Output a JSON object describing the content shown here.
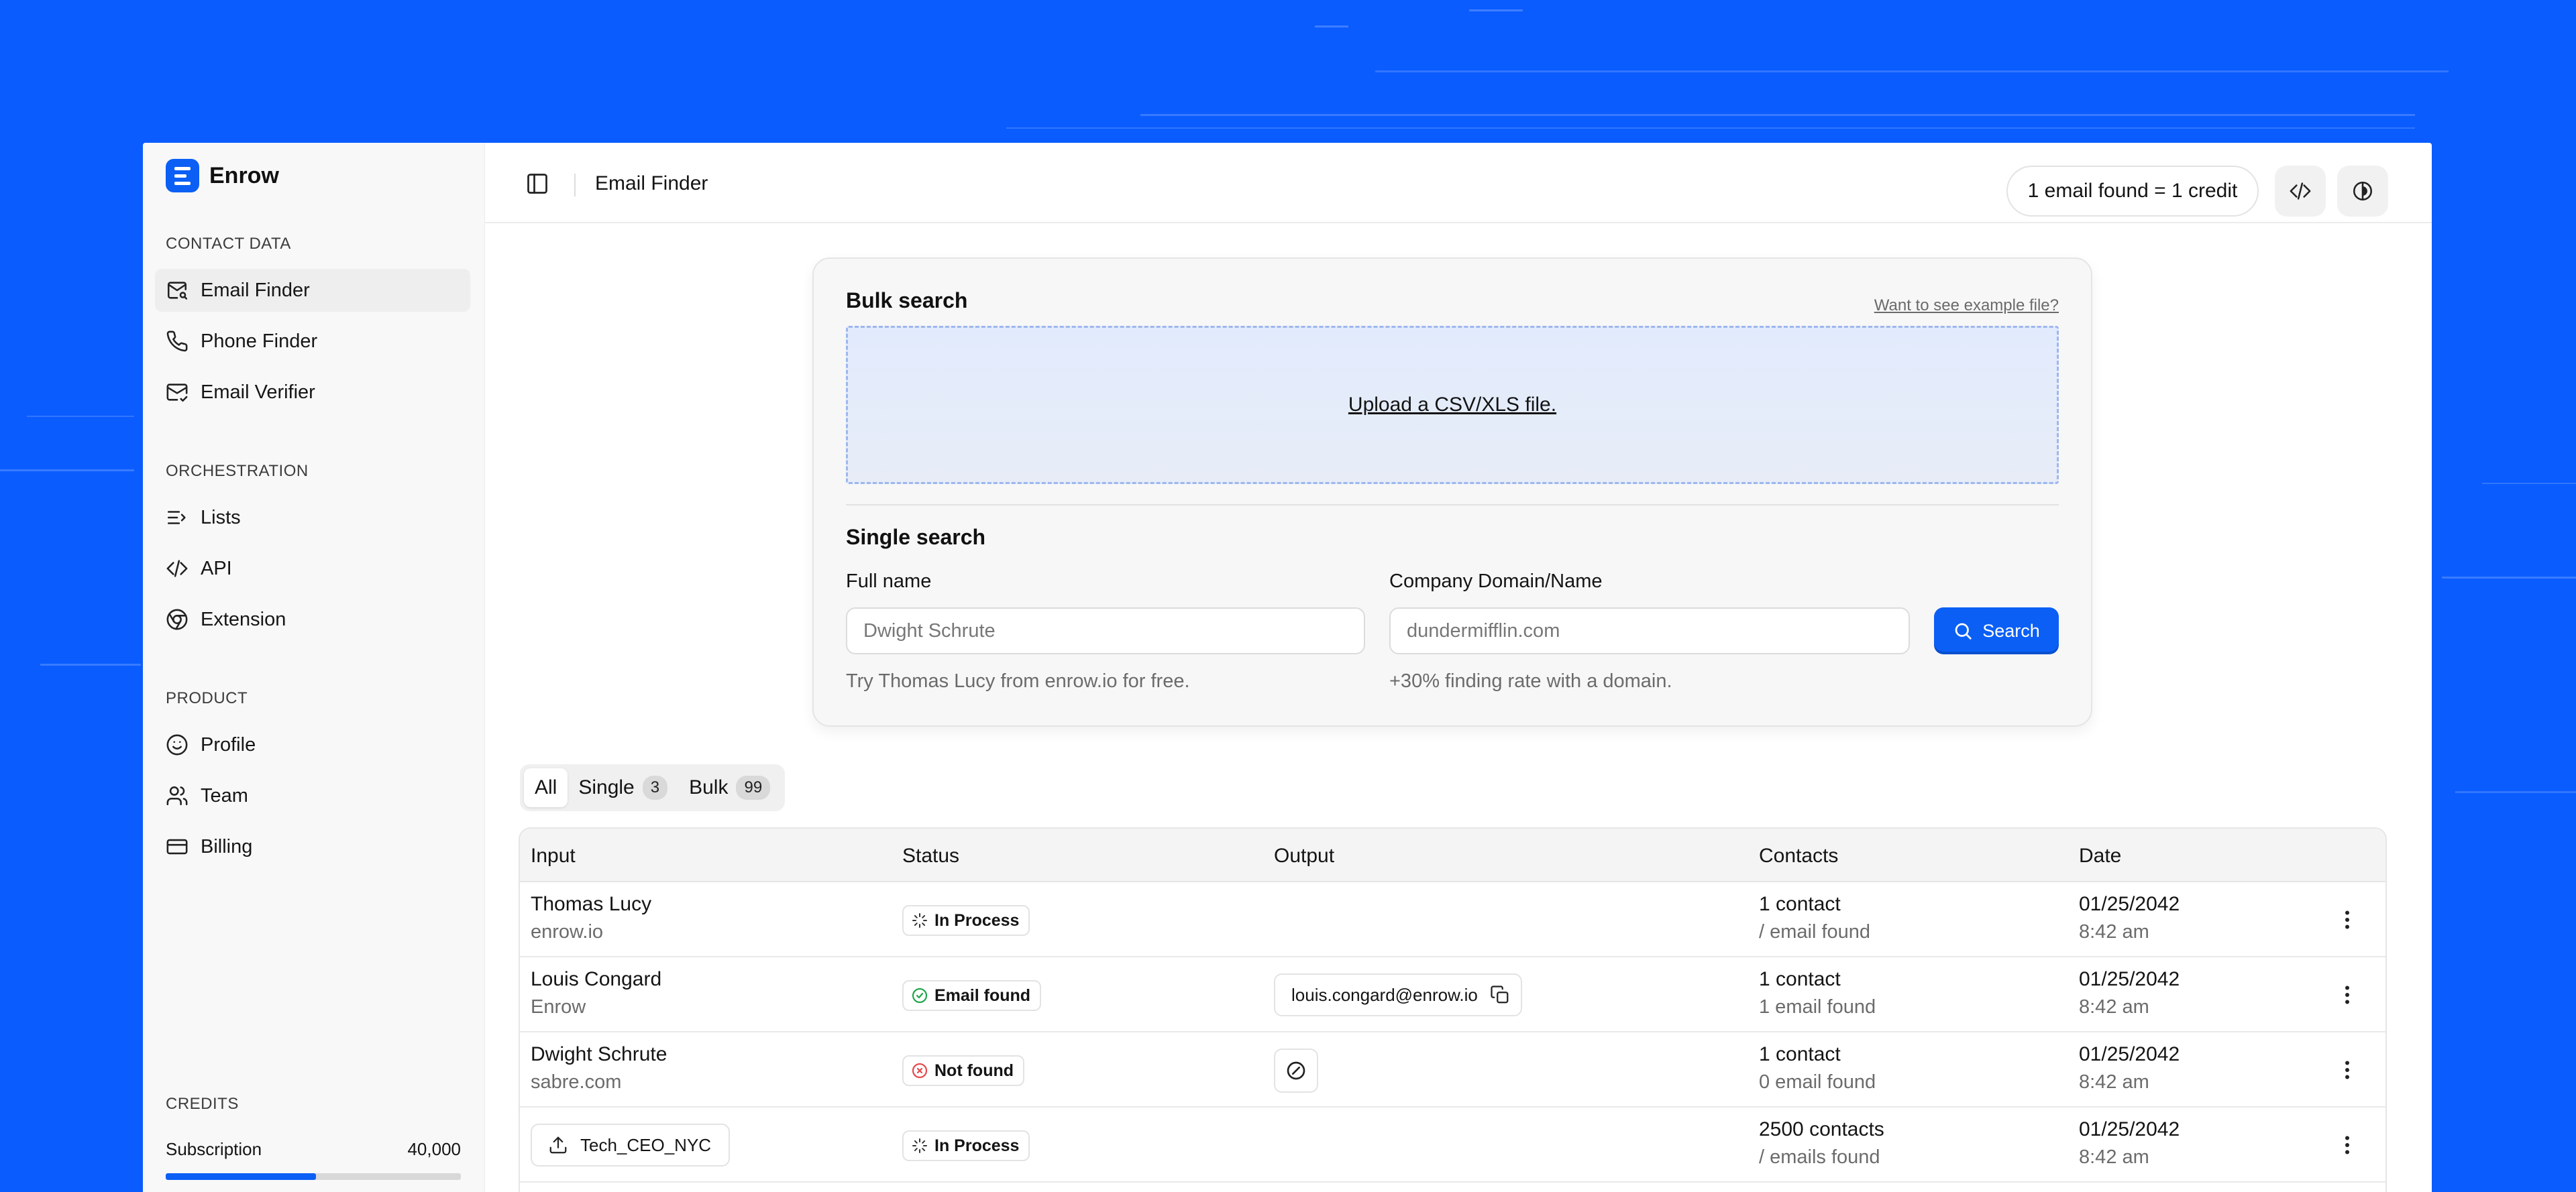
{
  "brand": {
    "name": "Enrow"
  },
  "sidebar": {
    "sections": [
      {
        "label": "CONTACT DATA"
      },
      {
        "label": "ORCHESTRATION"
      },
      {
        "label": "PRODUCT"
      },
      {
        "label": "CREDITS"
      }
    ],
    "items": [
      {
        "label": "Email Finder",
        "icon": "mail-search-icon",
        "active": true
      },
      {
        "label": "Phone Finder",
        "icon": "phone-icon"
      },
      {
        "label": "Email Verifier",
        "icon": "mail-check-icon"
      },
      {
        "label": "Lists",
        "icon": "list-icon"
      },
      {
        "label": "API",
        "icon": "code-icon"
      },
      {
        "label": "Extension",
        "icon": "chrome-icon"
      },
      {
        "label": "Profile",
        "icon": "smile-icon"
      },
      {
        "label": "Team",
        "icon": "users-icon"
      },
      {
        "label": "Billing",
        "icon": "credit-card-icon"
      }
    ],
    "credits": {
      "label": "Subscription",
      "value": "40,000",
      "usage_fraction": 0.51
    }
  },
  "header": {
    "title": "Email Finder",
    "credit_info": "1 email found = 1 credit"
  },
  "bulk": {
    "title": "Bulk search",
    "example_link": "Want to see example file?",
    "upload_label": "Upload a CSV/XLS file."
  },
  "single": {
    "title": "Single search",
    "name_label": "Full name",
    "name_placeholder": "Dwight Schrute",
    "name_hint": "Try Thomas Lucy from enrow.io for free.",
    "company_label": "Company Domain/Name",
    "company_placeholder": "dundermifflin.com",
    "company_hint": "+30% finding rate with a domain.",
    "search_label": "Search"
  },
  "tabs": [
    {
      "label": "All",
      "count": ""
    },
    {
      "label": "Single",
      "count": "3"
    },
    {
      "label": "Bulk",
      "count": "99"
    }
  ],
  "table": {
    "headers": [
      "Input",
      "Status",
      "Output",
      "Contacts",
      "Date"
    ],
    "rows": [
      {
        "input_name": "Thomas Lucy",
        "input_sub": "enrow.io",
        "status": "In Process",
        "output": "",
        "contacts": "1 contact",
        "contacts_sub": "/ email found",
        "date": "01/25/2042",
        "time": "8:42 am"
      },
      {
        "input_name": "Louis Congard",
        "input_sub": "Enrow",
        "status": "Email found",
        "output": "louis.congard@enrow.io",
        "contacts": "1 contact",
        "contacts_sub": "1 email found",
        "date": "01/25/2042",
        "time": "8:42 am"
      },
      {
        "input_name": "Dwight Schrute",
        "input_sub": "sabre.com",
        "status": "Not found",
        "output": "",
        "contacts": "1 contact",
        "contacts_sub": "0 email found",
        "date": "01/25/2042",
        "time": "8:42 am"
      },
      {
        "input_file": "Tech_CEO_NYC",
        "status": "In Process",
        "output": "",
        "contacts": "2500 contacts",
        "contacts_sub": "/ emails found",
        "date": "01/25/2042",
        "time": "8:42 am"
      }
    ]
  },
  "colors": {
    "accent": "#0b5ff5",
    "background": "#0a5cff",
    "success": "#1fa64a",
    "error": "#e5484d"
  }
}
